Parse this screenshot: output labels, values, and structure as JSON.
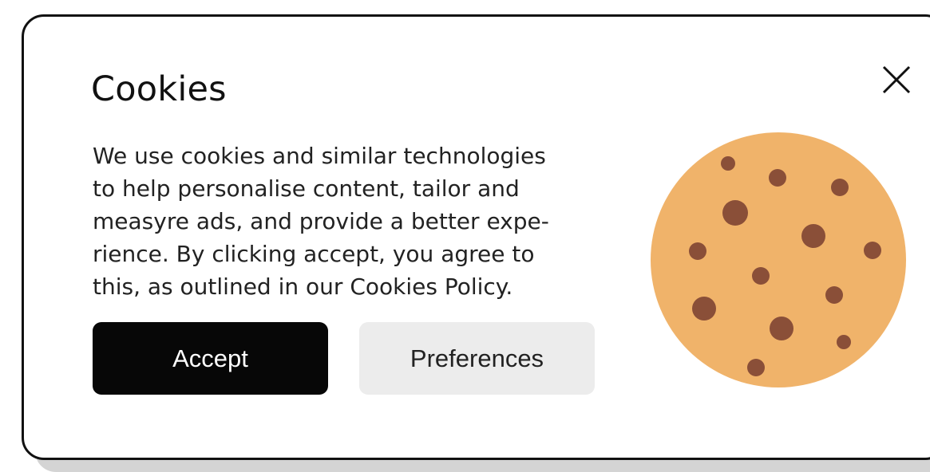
{
  "dialog": {
    "title": "Cookies",
    "message": "We use cookies and similar technologies\nto help personalise content, tailor and\nmeasyre ads, and provide a better expe-\nrience. By clicking accept, you agree to\nthis, as outlined in our Cookies Policy.",
    "close_icon": "close-icon",
    "accept_label": "Accept",
    "preferences_label": "Preferences",
    "illustration_icon": "cookie-icon"
  },
  "colors": {
    "text": "#111111",
    "accept_background": "#070707",
    "accept_text": "#ffffff",
    "preferences_background": "#ececec",
    "cookie_dough": "#f0b36a",
    "cookie_chip": "#8a4f38"
  }
}
